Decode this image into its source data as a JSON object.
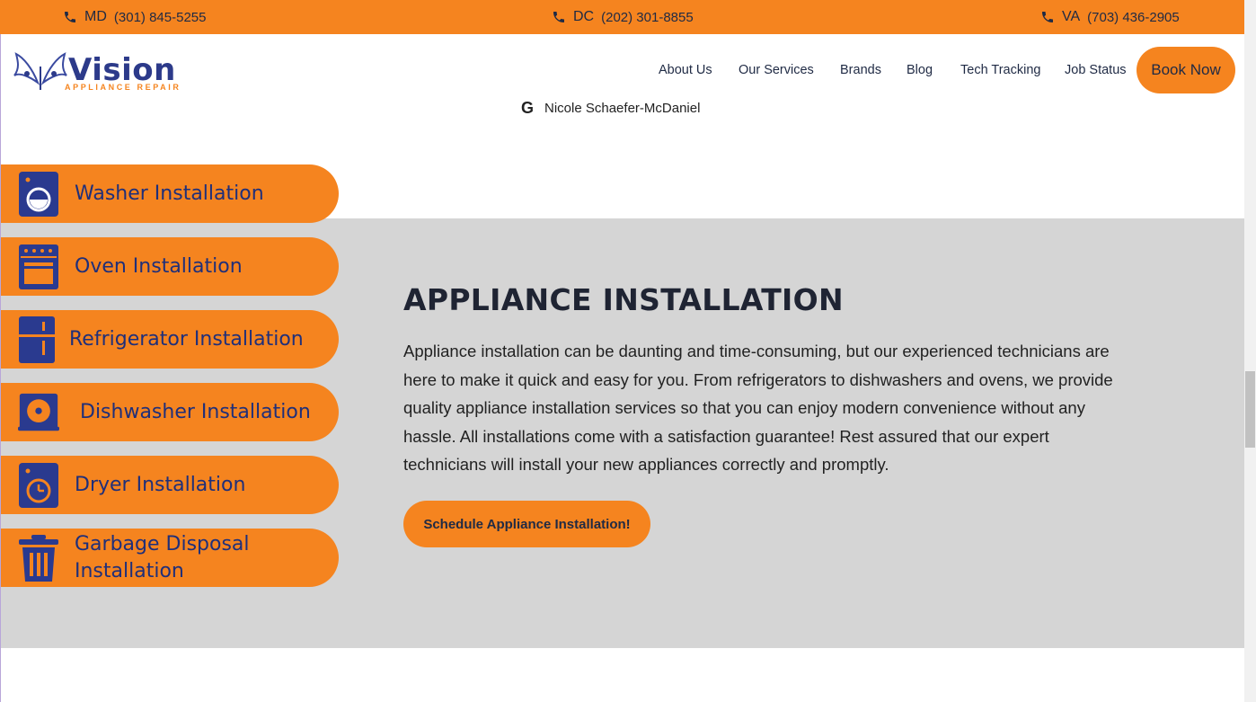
{
  "topbar": {
    "phones": [
      {
        "state": "MD",
        "number": "(301) 845-5255"
      },
      {
        "state": "DC",
        "number": "(202) 301-8855"
      },
      {
        "state": "VA",
        "number": "(703) 436-2905"
      }
    ]
  },
  "header": {
    "logo_word": "Vision",
    "logo_sub": "APPLIANCE REPAIR",
    "nav": [
      "About Us",
      "Our Services",
      "Brands",
      "Blog",
      "Tech Tracking",
      "Job Status"
    ],
    "book_label": "Book Now"
  },
  "review": {
    "author": "Nicole Schaefer-McDaniel"
  },
  "services": [
    {
      "label": "Washer Installation",
      "icon": "washer-icon"
    },
    {
      "label": "Oven Installation",
      "icon": "oven-icon"
    },
    {
      "label": "Refrigerator Installation",
      "icon": "refrigerator-icon"
    },
    {
      "label": "Dishwasher Installation",
      "icon": "dishwasher-icon"
    },
    {
      "label": "Dryer Installation",
      "icon": "dryer-icon"
    },
    {
      "label_line1": "Garbage Disposal",
      "label_line2": "Installation",
      "icon": "trash-icon"
    }
  ],
  "main": {
    "title": "APPLIANCE INSTALLATION",
    "description": "Appliance installation can be daunting and time-consuming, but our experienced technicians are here to make it quick and easy for you. From refrigerators to dishwashers and ovens, we provide quality appliance installation services so that you can enjoy modern convenience without any hassle. All installations come with a satisfaction guarantee! Rest assured that our expert technicians will install your new appliances correctly and promptly.",
    "cta_label": "Schedule Appliance Installation!"
  },
  "colors": {
    "accent": "#f5841f",
    "brand_blue": "#2c3a8a",
    "section_gray": "#d5d5d5"
  }
}
